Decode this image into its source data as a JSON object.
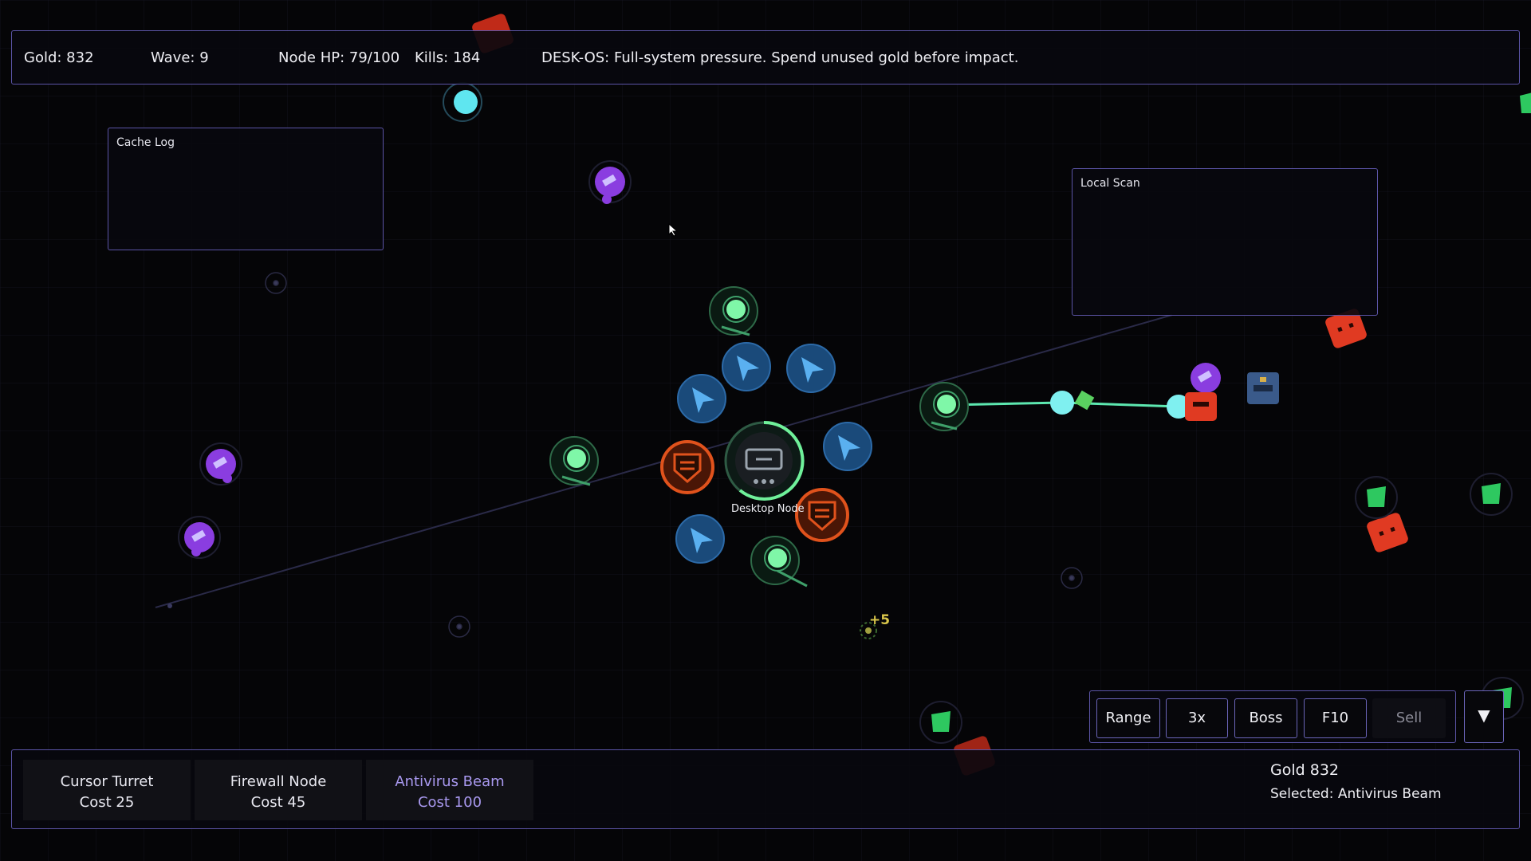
{
  "hud": {
    "gold": "Gold: 832",
    "wave": "Wave: 9",
    "node_hp": "Node HP: 79/100",
    "kills": "Kills: 184",
    "message": "DESK-OS: Full-system pressure. Spend unused gold before impact."
  },
  "panels": {
    "cache_log_title": "Cache Log",
    "local_scan_title": "Local Scan"
  },
  "map": {
    "core_label": "Desktop Node",
    "reward_popup": "+5"
  },
  "controls": {
    "range": "Range",
    "speed": "3x",
    "boss": "Boss",
    "f10": "F10",
    "sell": "Sell",
    "collapse_icon": "▼"
  },
  "shop": {
    "towers": [
      {
        "name": "Cursor Turret",
        "cost": "Cost 25"
      },
      {
        "name": "Firewall Node",
        "cost": "Cost 45"
      },
      {
        "name": "Antivirus Beam",
        "cost": "Cost 100"
      }
    ],
    "gold": "Gold 832",
    "selected": "Selected: Antivirus Beam"
  },
  "colors": {
    "panel_border": "#5b54a6",
    "selected_text": "#a898ee",
    "cursor_turret": "#3d8fd8",
    "firewall": "#e0521c",
    "antivirus": "#6ff09a",
    "beam": "#5de8b0",
    "virus_purple": "#8a3de0",
    "enemy_red": "#e03a22",
    "enemy_green": "#2ec860"
  }
}
